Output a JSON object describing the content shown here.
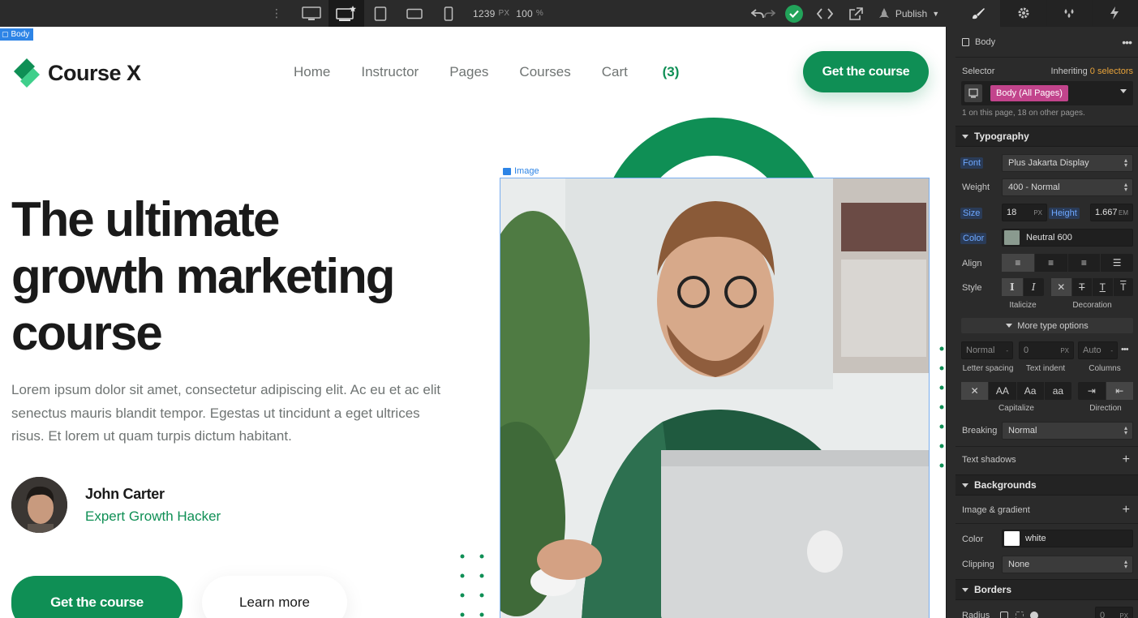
{
  "toolbar": {
    "size_value": "1239",
    "size_unit": "PX",
    "zoom_value": "100",
    "zoom_unit": "%",
    "publish_label": "Publish"
  },
  "canvas": {
    "body_tag": "Body",
    "image_tag": "Image",
    "logo_text": "Course X",
    "nav": [
      "Home",
      "Instructor",
      "Pages",
      "Courses"
    ],
    "cart_label": "Cart",
    "cart_count": "(3)",
    "header_button": "Get the course",
    "hero_title_lines": [
      "The ultimate",
      "growth marketing",
      "course"
    ],
    "hero_text": "Lorem ipsum dolor sit amet, consectetur adipiscing elit. Ac eu et ac elit senectus mauris blandit tempor. Egestas ut tincidunt a eget ultrices risus. Et lorem ut quam turpis dictum habitant.",
    "author_name": "John Carter",
    "author_role": "Expert Growth Hacker",
    "cta_button": "Get the course",
    "learn_button": "Learn more",
    "accent_color": "#0f8f55"
  },
  "panel": {
    "element_name": "Body",
    "selector_label": "Selector",
    "inheriting_label": "Inheriting",
    "inheriting_count": "0 selectors",
    "selector_chip": "Body (All Pages)",
    "selector_info": "1 on this page, 18 on other pages.",
    "typography": {
      "title": "Typography",
      "font_label": "Font",
      "font_value": "Plus Jakarta Display",
      "weight_label": "Weight",
      "weight_value": "400 - Normal",
      "size_label": "Size",
      "size_value": "18",
      "size_unit": "PX",
      "height_label": "Height",
      "height_value": "1.667",
      "height_unit": "EM",
      "color_label": "Color",
      "color_value": "Neutral 600",
      "color_swatch": "#8a9a8f",
      "align_label": "Align",
      "style_label": "Style",
      "italicize_label": "Italicize",
      "decoration_label": "Decoration",
      "more_options": "More type options",
      "letter_spacing_value": "Normal",
      "letter_spacing_label": "Letter spacing",
      "text_indent_value": "0",
      "text_indent_unit": "PX",
      "text_indent_label": "Text indent",
      "columns_value": "Auto",
      "columns_label": "Columns",
      "capitalize_label": "Capitalize",
      "capitalize_options": [
        "✕",
        "AA",
        "Aa",
        "aa"
      ],
      "direction_label": "Direction",
      "breaking_label": "Breaking",
      "breaking_value": "Normal",
      "text_shadows_label": "Text shadows"
    },
    "backgrounds": {
      "title": "Backgrounds",
      "image_gradient_label": "Image & gradient",
      "color_label": "Color",
      "color_value": "white",
      "clipping_label": "Clipping",
      "clipping_value": "None"
    },
    "borders": {
      "title": "Borders",
      "radius_label": "Radius",
      "radius_value": "0",
      "radius_unit": "PX"
    }
  }
}
